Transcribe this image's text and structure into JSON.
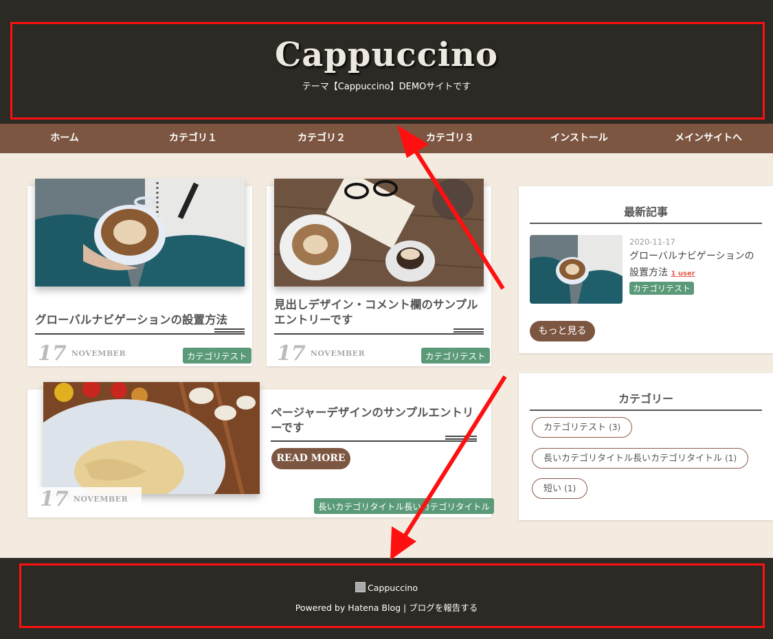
{
  "header": {
    "title": "Cappuccino",
    "description": "テーマ【Cappuccino】DEMOサイトです"
  },
  "nav": {
    "items": [
      {
        "label": "ホーム"
      },
      {
        "label": "カテゴリ１"
      },
      {
        "label": "カテゴリ２"
      },
      {
        "label": "カテゴリ３"
      },
      {
        "label": "インストール"
      },
      {
        "label": "メインサイトへ"
      }
    ]
  },
  "entries": [
    {
      "title": "グローバルナビゲーションの設置方法",
      "day": "17",
      "month": "NOVEMBER",
      "category": "カテゴリテスト"
    },
    {
      "title": "見出しデザイン・コメント欄のサンプルエントリーです",
      "day": "17",
      "month": "NOVEMBER",
      "category": "カテゴリテスト"
    },
    {
      "title": "ページャーデザインのサンプルエントリーです",
      "day": "17",
      "month": "NOVEMBER",
      "category": "長いカテゴリタイトル長いカテゴリタイトル",
      "read_more": "READ MORE"
    }
  ],
  "sidebar": {
    "recent": {
      "title": "最新記事",
      "item": {
        "date": "2020-11-17",
        "title": "グローバルナビゲーションの設置方法",
        "users": "1 user",
        "category": "カテゴリテスト"
      },
      "more_label": "もっと見る"
    },
    "categories": {
      "title": "カテゴリー",
      "items": [
        {
          "label": "カテゴリテスト",
          "count": "(3)"
        },
        {
          "label": "長いカテゴリタイトル長いカテゴリタイトル",
          "count": "(1)"
        },
        {
          "label": "短い",
          "count": "(1)"
        }
      ]
    }
  },
  "footer": {
    "brand": "Cappuccino",
    "powered": "Powered by Hatena Blog",
    "separator": " | ",
    "report": "ブログを報告する"
  },
  "colors": {
    "header_bg": "#2c2a25",
    "nav_bg": "#7d5642",
    "page_bg": "#f3ebe0",
    "tag_green": "#5a9a78",
    "highlight_red": "#ff1010"
  }
}
